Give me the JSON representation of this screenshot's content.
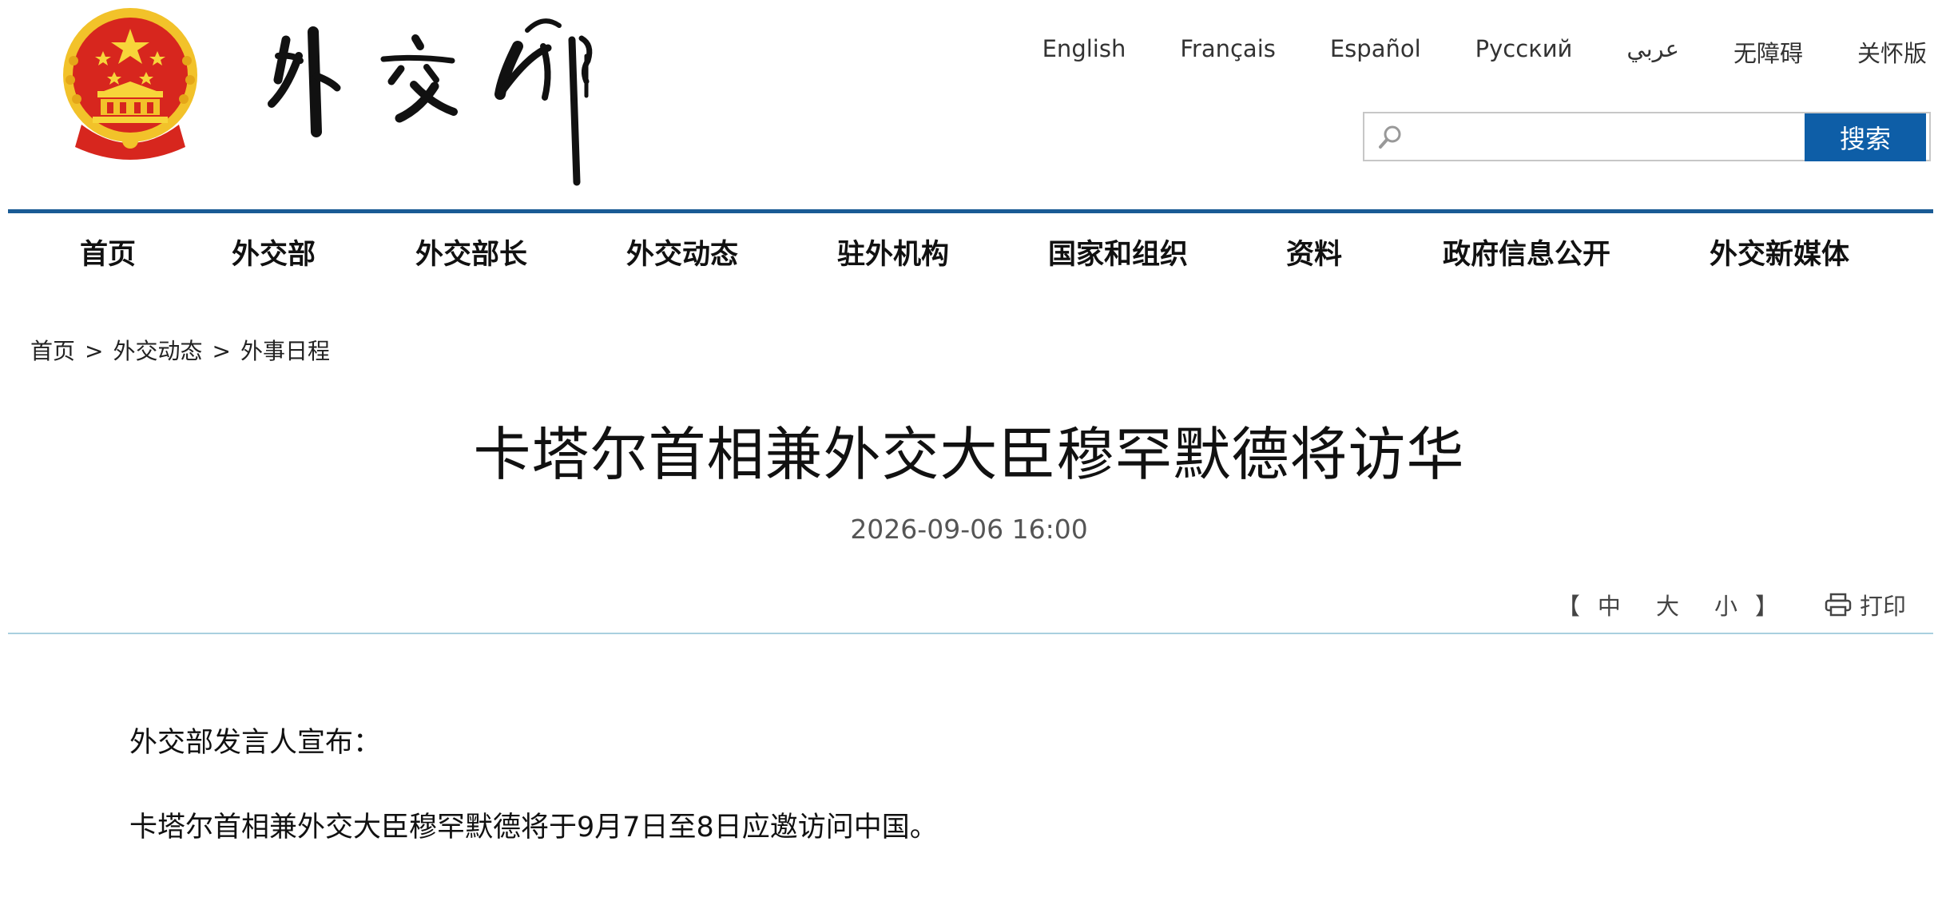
{
  "header": {
    "languages": [
      "English",
      "Français",
      "Español",
      "Русский",
      "عربي",
      "无障碍",
      "关怀版"
    ],
    "search": {
      "placeholder": "",
      "button_label": "搜索"
    }
  },
  "nav": {
    "items": [
      "首页",
      "外交部",
      "外交部长",
      "外交动态",
      "驻外机构",
      "国家和组织",
      "资料",
      "政府信息公开",
      "外交新媒体"
    ]
  },
  "breadcrumb": {
    "items": [
      "首页",
      "外交动态",
      "外事日程"
    ],
    "separator": ">"
  },
  "article": {
    "title": "卡塔尔首相兼外交大臣穆罕默德将访华",
    "date": "2026-09-06 16:00",
    "font_tools": {
      "open": "【",
      "sizes": [
        "中",
        "大",
        "小"
      ],
      "close": "】",
      "print_label": "打印"
    },
    "paragraphs": [
      "外交部发言人宣布：",
      "卡塔尔首相兼外交大臣穆罕默德将于9月7日至8日应邀访问中国。"
    ]
  },
  "colors": {
    "nav_rule": "#1a5b95",
    "search_button": "#0e5ea7",
    "content_rule": "#a9d0df",
    "emblem_red": "#d7261e",
    "emblem_gold": "#f2c22a"
  },
  "icons": [
    "national-emblem",
    "calligraphy-logo",
    "search-icon",
    "print-icon"
  ]
}
